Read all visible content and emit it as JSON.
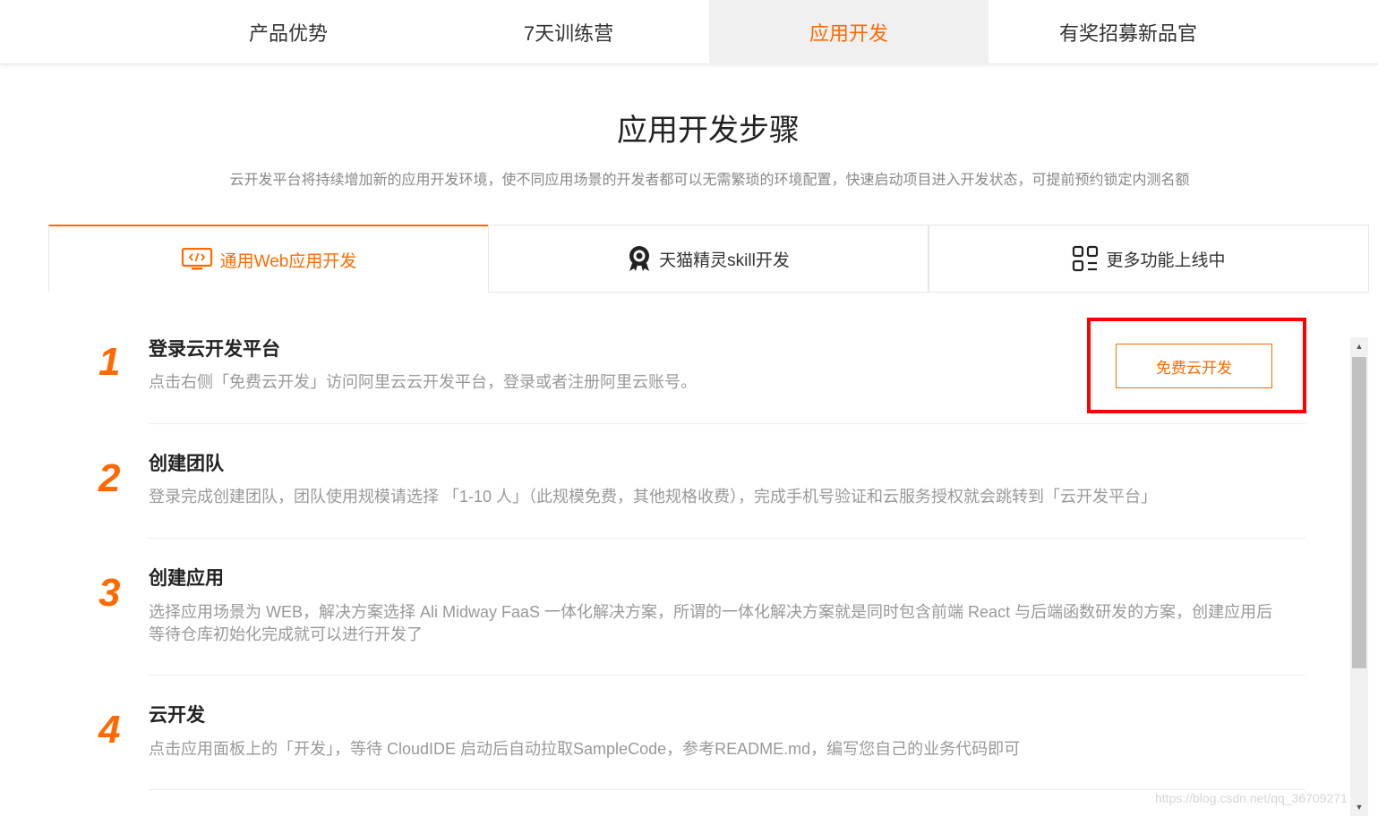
{
  "nav": {
    "items": [
      {
        "label": "产品优势"
      },
      {
        "label": "7天训练营"
      },
      {
        "label": "应用开发"
      },
      {
        "label": "有奖招募新品官"
      }
    ]
  },
  "section": {
    "title": "应用开发步骤",
    "subtitle": "云开发平台将持续增加新的应用开发环境，使不同应用场景的开发者都可以无需繁琐的环境配置，快速启动项目进入开发状态，可提前预约锁定内测名额"
  },
  "tabs": [
    {
      "label": "通用Web应用开发",
      "icon": "web-dev-icon"
    },
    {
      "label": "天猫精灵skill开发",
      "icon": "tmall-genie-icon"
    },
    {
      "label": "更多功能上线中",
      "icon": "grid-icon"
    }
  ],
  "steps": [
    {
      "number": "1",
      "title": "登录云开发平台",
      "desc": "点击右侧「免费云开发」访问阿里云云开发平台，登录或者注册阿里云账号。"
    },
    {
      "number": "2",
      "title": "创建团队",
      "desc": "登录完成创建团队，团队使用规模请选择 「1-10 人」（此规模免费，其他规格收费），完成手机号验证和云服务授权就会跳转到「云开发平台」"
    },
    {
      "number": "3",
      "title": "创建应用",
      "desc": "选择应用场景为 WEB，解决方案选择 Ali Midway FaaS 一体化解决方案，所谓的一体化解决方案就是同时包含前端 React 与后端函数研发的方案，创建应用后等待仓库初始化完成就可以进行开发了"
    },
    {
      "number": "4",
      "title": "云开发",
      "desc": "点击应用面板上的「开发」，等待 CloudIDE 启动后自动拉取SampleCode，参考README.md，编写您自己的业务代码即可"
    }
  ],
  "cta": {
    "label": "免费云开发"
  },
  "watermark": "https://blog.csdn.net/qq_36709271",
  "colors": {
    "accent": "#ff6a00",
    "highlight": "#ff0000"
  }
}
